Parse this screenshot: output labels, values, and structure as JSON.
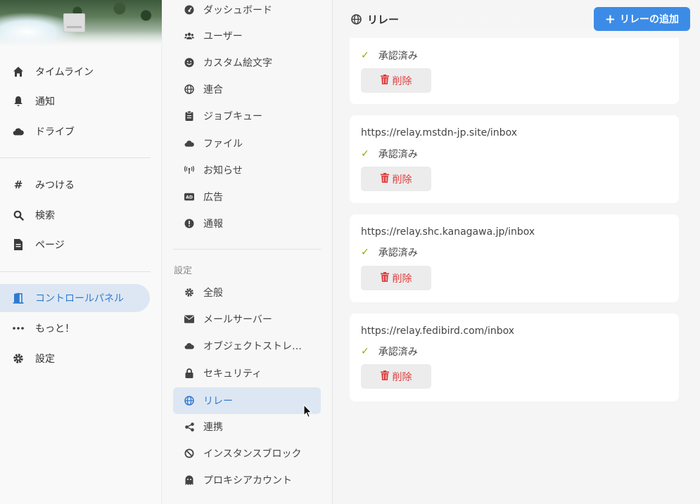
{
  "nav": {
    "items_top": [
      {
        "icon": "home-icon",
        "label": "タイムライン"
      },
      {
        "icon": "bell-icon",
        "label": "通知"
      },
      {
        "icon": "cloud-icon",
        "label": "ドライブ"
      }
    ],
    "items_mid": [
      {
        "icon": "hash-icon",
        "label": "みつける"
      },
      {
        "icon": "search-icon",
        "label": "検索"
      },
      {
        "icon": "page-icon",
        "label": "ページ"
      }
    ],
    "items_bottom": [
      {
        "icon": "door-icon",
        "label": "コントロールパネル",
        "active": true
      },
      {
        "icon": "ellipsis-icon",
        "label": "もっと！"
      },
      {
        "icon": "gear-icon",
        "label": "設定"
      }
    ]
  },
  "menu": {
    "items_top": [
      {
        "icon": "gauge-icon",
        "label": "ダッシュボード"
      },
      {
        "icon": "users-icon",
        "label": "ユーザー"
      },
      {
        "icon": "smile-icon",
        "label": "カスタム絵文字"
      },
      {
        "icon": "globe-icon",
        "label": "連合"
      },
      {
        "icon": "clipboard-icon",
        "label": "ジョブキュー"
      },
      {
        "icon": "cloud-icon",
        "label": "ファイル"
      },
      {
        "icon": "broadcast-icon",
        "label": "お知らせ"
      },
      {
        "icon": "ad-icon",
        "label": "広告"
      },
      {
        "icon": "alert-icon",
        "label": "通報"
      }
    ],
    "settings_heading": "設定",
    "items_settings": [
      {
        "icon": "gear-icon",
        "label": "全般"
      },
      {
        "icon": "envelope-icon",
        "label": "メールサーバー"
      },
      {
        "icon": "cloud-icon",
        "label": "オブジェクトストレ…"
      },
      {
        "icon": "lock-icon",
        "label": "セキュリティ"
      },
      {
        "icon": "globe-icon",
        "label": "リレー",
        "active": true
      },
      {
        "icon": "share-icon",
        "label": "連携"
      },
      {
        "icon": "ban-icon",
        "label": "インスタンスブロック"
      },
      {
        "icon": "ghost-icon",
        "label": "プロキシアカウント"
      }
    ]
  },
  "main": {
    "title": "リレー",
    "add_button": "リレーの追加",
    "relays": [
      {
        "url": "",
        "status": "承認済み",
        "delete": "削除"
      },
      {
        "url": "https://relay.mstdn-jp.site/inbox",
        "status": "承認済み",
        "delete": "削除"
      },
      {
        "url": "https://relay.shc.kanagawa.jp/inbox",
        "status": "承認済み",
        "delete": "削除"
      },
      {
        "url": "https://relay.fedibird.com/inbox",
        "status": "承認済み",
        "delete": "削除"
      }
    ]
  },
  "colors": {
    "accent": "#3c8ce7",
    "active_bg": "#dde7f3",
    "danger": "#e03c3c",
    "ok": "#86b300"
  }
}
